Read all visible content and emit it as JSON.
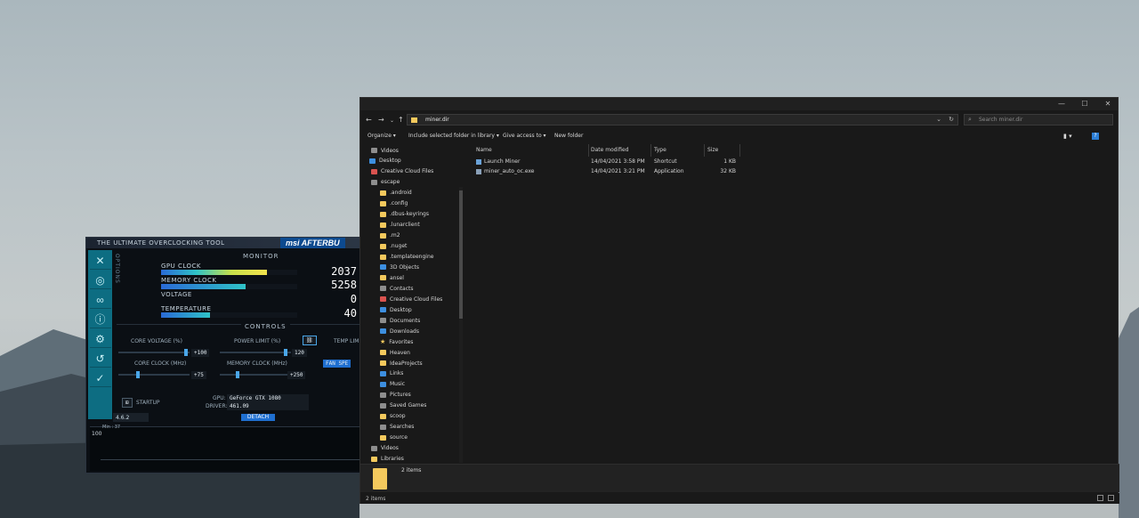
{
  "afterburner": {
    "tagline": "THE ULTIMATE OVERCLOCKING TOOL",
    "logo": "msi AFTERBU",
    "options_label": "OPTIONS",
    "monitor_title": "MONITOR",
    "controls_title": "CONTROLS",
    "gpu_clock_label": "GPU CLOCK",
    "gpu_clock_value": "2037",
    "gpu_clock_level": 0.78,
    "memory_clock_label": "MEMORY CLOCK",
    "memory_clock_value": "5258",
    "memory_clock_level": 0.62,
    "voltage_label": "VOLTAGE",
    "voltage_value": "0",
    "temperature_label": "TEMPERATURE",
    "temperature_value": "40",
    "temperature_level": 0.36,
    "core_voltage_label": "CORE VOLTAGE (%)",
    "core_voltage_value": "+100",
    "power_limit_label": "POWER LIMIT (%)",
    "power_limit_value": "120",
    "temp_limit_label": "TEMP LIM",
    "core_clock_label": "CORE CLOCK (MHz)",
    "core_clock_value": "+75",
    "memory_clock_ctrl_label": "MEMORY CLOCK (MHz)",
    "memory_clock_ctrl_value": "+250",
    "fan_speed_label": "FAN SPE",
    "startup_label": "STARTUP",
    "gpu_label": "GPU:",
    "gpu_value": "GeForce GTX 1080",
    "driver_label": "DRIVER:",
    "driver_value": "461.09",
    "version": "4.6.2",
    "detach_label": "DETACH",
    "graph_ymax": "100",
    "graph_min_label": "Min : 37"
  },
  "explorer": {
    "address": "miner.dir",
    "search_placeholder": "Search miner.dir",
    "toolbar": {
      "organize": "Organize ▾",
      "include": "Include selected folder in library ▾",
      "give_access": "Give access to ▾",
      "new_folder": "New folder"
    },
    "nav_items": [
      {
        "label": "Videos",
        "icon": "gray"
      },
      {
        "label": "Desktop",
        "icon": "blue"
      },
      {
        "label": "Creative Cloud Files",
        "icon": "red"
      },
      {
        "label": "escape",
        "icon": "gray"
      },
      {
        "label": ".android",
        "icon": "folder"
      },
      {
        "label": ".config",
        "icon": "folder"
      },
      {
        "label": ".dbus-keyrings",
        "icon": "folder"
      },
      {
        "label": ".lunarclient",
        "icon": "folder"
      },
      {
        "label": ".m2",
        "icon": "folder"
      },
      {
        "label": ".nuget",
        "icon": "folder"
      },
      {
        "label": ".templateengine",
        "icon": "folder"
      },
      {
        "label": "3D Objects",
        "icon": "blue"
      },
      {
        "label": "ansel",
        "icon": "folder"
      },
      {
        "label": "Contacts",
        "icon": "gray"
      },
      {
        "label": "Creative Cloud Files",
        "icon": "red"
      },
      {
        "label": "Desktop",
        "icon": "blue"
      },
      {
        "label": "Documents",
        "icon": "gray"
      },
      {
        "label": "Downloads",
        "icon": "blue"
      },
      {
        "label": "Favorites",
        "icon": "star"
      },
      {
        "label": "Heaven",
        "icon": "folder"
      },
      {
        "label": "IdeaProjects",
        "icon": "folder"
      },
      {
        "label": "Links",
        "icon": "blue"
      },
      {
        "label": "Music",
        "icon": "blue"
      },
      {
        "label": "Pictures",
        "icon": "gray"
      },
      {
        "label": "Saved Games",
        "icon": "gray"
      },
      {
        "label": "scoop",
        "icon": "folder"
      },
      {
        "label": "Searches",
        "icon": "gray"
      },
      {
        "label": "source",
        "icon": "folder"
      },
      {
        "label": "Videos",
        "icon": "gray"
      },
      {
        "label": "Libraries",
        "icon": "folder"
      }
    ],
    "columns": [
      "Name",
      "Date modified",
      "Type",
      "Size"
    ],
    "files": [
      {
        "name": "Launch Miner",
        "date": "14/04/2021 3:58 PM",
        "type": "Shortcut",
        "size": "1 KB"
      },
      {
        "name": "miner_auto_oc.exe",
        "date": "14/04/2021 3:21 PM",
        "type": "Application",
        "size": "32 KB"
      }
    ],
    "details_count": "2 items",
    "status": "2 items"
  }
}
